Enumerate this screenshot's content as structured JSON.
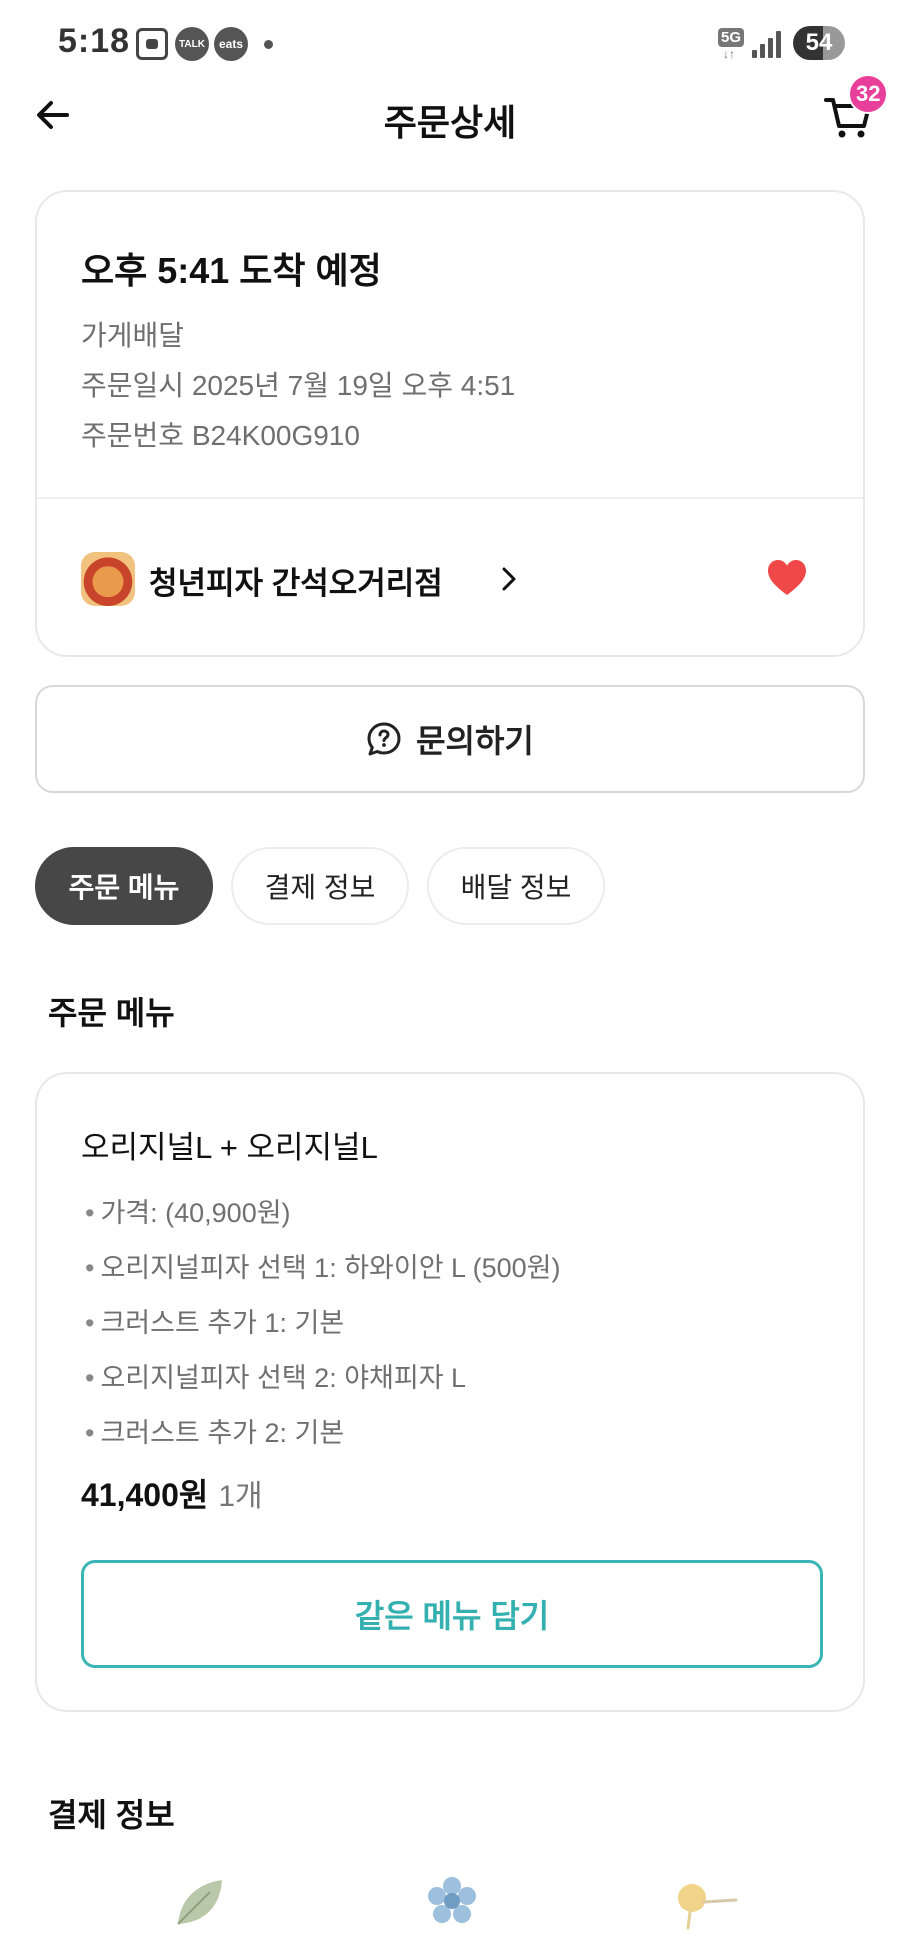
{
  "status_bar": {
    "time": "5:18",
    "talk_label": "TALK",
    "eats_label": "eats",
    "network": "5G",
    "network_arrows": "↓↑",
    "battery": "54"
  },
  "header": {
    "title": "주문상세",
    "cart_count": "32"
  },
  "order": {
    "arrival": "오후 5:41 도착 예정",
    "delivery_type": "가게배달",
    "order_datetime": "주문일시 2025년 7월 19일 오후 4:51",
    "order_number": "주문번호 B24K00G910",
    "store_name": "청년피자 간석오거리점",
    "favorite": true
  },
  "inquiry": {
    "label": "문의하기"
  },
  "tabs": [
    {
      "label": "주문 메뉴",
      "active": true
    },
    {
      "label": "결제 정보",
      "active": false
    },
    {
      "label": "배달 정보",
      "active": false
    }
  ],
  "menu_section": {
    "title": "주문 메뉴",
    "item": {
      "name": "오리지널L + 오리지널L",
      "options": [
        "가격: (40,900원)",
        "오리지널피자 선택 1: 하와이안 L (500원)",
        "크러스트 추가 1: 기본",
        "오리지널피자 선택 2: 야채피자 L",
        "크러스트 추가 2: 기본"
      ],
      "price": "41,400원",
      "quantity": "1개"
    },
    "same_menu_label": "같은 메뉴 담기"
  },
  "payment_section": {
    "title": "결제 정보"
  },
  "colors": {
    "accent_teal": "#35b0b0",
    "badge_pink": "#e8409a",
    "heart_red": "#f04848",
    "active_tab": "#474747"
  },
  "icons": {
    "back": "arrow-left-icon",
    "cart": "cart-icon",
    "store_chevron": "chevron-right-icon",
    "favorite": "heart-icon",
    "inquiry": "question-bubble-icon",
    "decorations": [
      "leaf-icon",
      "flower-icon",
      "dandelion-icon"
    ]
  }
}
